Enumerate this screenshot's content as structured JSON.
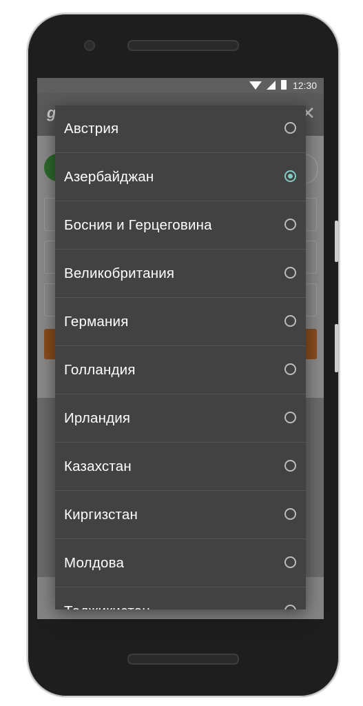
{
  "status_bar": {
    "time": "12:30"
  },
  "app_bar": {
    "logo_text": "g",
    "close_icon": "close-icon"
  },
  "accent_color": "#80cbc4",
  "dialog": {
    "options": [
      {
        "label": "Австрия",
        "selected": false
      },
      {
        "label": "Азербайджан",
        "selected": true
      },
      {
        "label": "Босния и Герцеговина",
        "selected": false
      },
      {
        "label": "Великобритания",
        "selected": false
      },
      {
        "label": "Германия",
        "selected": false
      },
      {
        "label": "Голландия",
        "selected": false
      },
      {
        "label": "Ирландия",
        "selected": false
      },
      {
        "label": "Казахстан",
        "selected": false
      },
      {
        "label": "Киргизстан",
        "selected": false
      },
      {
        "label": "Молдова",
        "selected": false
      },
      {
        "label": "Таджикистан",
        "selected": false
      }
    ]
  }
}
